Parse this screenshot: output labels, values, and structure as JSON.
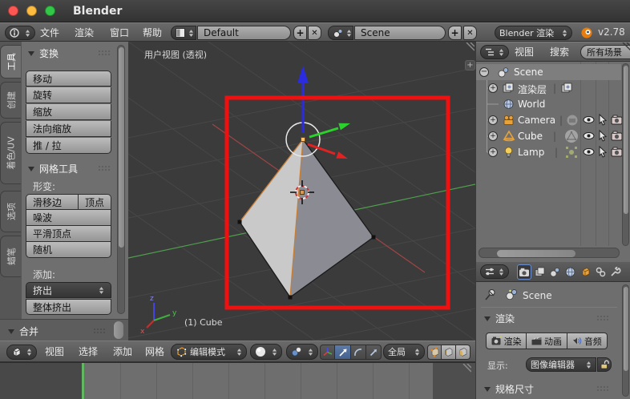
{
  "window": {
    "title": "Blender"
  },
  "topbar": {
    "menus": {
      "file": "文件",
      "render": "渲染",
      "window": "窗口",
      "help": "帮助"
    },
    "layout_name": "Default",
    "scene_name": "Scene",
    "engine": "Blender 渲染",
    "version": "v2.78",
    "add_btn": "+",
    "del_btn": "✕"
  },
  "toolshelf": {
    "tabs": {
      "tools": "工具",
      "create": "创建",
      "shading": "着色/UV",
      "options": "选项",
      "grease": "蜡笔"
    },
    "transform_title": "变换",
    "btn_translate": "移动",
    "btn_rotate": "旋转",
    "btn_scale": "缩放",
    "btn_shrink_fatten": "法向缩放",
    "btn_push_pull": "推 / 拉",
    "meshtools_title": "网格工具",
    "deform_label": "形变:",
    "btn_edge_slide": "滑移边",
    "btn_vertex": "顶点",
    "btn_noise": "噪波",
    "btn_smooth_vertex": "平滑顶点",
    "btn_randomize": "随机",
    "add_label": "添加:",
    "dd_extrude": "挤出",
    "btn_extrude_region": "整体挤出",
    "merge_title": "合并"
  },
  "viewport": {
    "view_label": "用户视图 (透视)",
    "object_label": "(1) Cube",
    "expand_btn": "+",
    "axis_x": "x",
    "axis_y": "y",
    "axis_z": "z"
  },
  "outliner": {
    "menus": {
      "view": "视图",
      "search": "搜索"
    },
    "display_mode": "所有场景",
    "separator": "|",
    "collapse": "−",
    "expand": "+",
    "rows": [
      {
        "name": "Scene"
      },
      {
        "name": "渲染层"
      },
      {
        "name": "World"
      },
      {
        "name": "Camera"
      },
      {
        "name": "Cube"
      },
      {
        "name": "Lamp"
      }
    ]
  },
  "properties": {
    "context": "Scene",
    "render_title": "渲染",
    "btn_render": "渲染",
    "btn_animation": "动画",
    "btn_audio": "音频",
    "display_label": "显示:",
    "display_value": "图像编辑器",
    "dimensions_title": "规格尺寸"
  },
  "view3d_header": {
    "menus": {
      "view": "视图",
      "select": "选择",
      "add": "添加",
      "mesh": "网格"
    },
    "mode": "编辑模式",
    "orientation": "全局"
  },
  "icons": {
    "traffic-close-icon": "red circle",
    "traffic-minimize-icon": "yellow circle",
    "traffic-zoom-icon": "green circle",
    "info-editor-icon": "circled i",
    "layout-icon": "split rectangle",
    "scene-icon": "two balls",
    "blender-logo-icon": "orange swirl",
    "outliner-editor-icon": "indented list",
    "world-icon": "globe",
    "renderlayer-icon": "stacked photos",
    "camera-object-icon": "orange camera",
    "cone-object-icon": "orange cone",
    "lamp-object-icon": "yellow bulb",
    "eye-icon": "visibility eye",
    "cursor-icon": "mouse pointer",
    "camera-restrict-icon": "small camera",
    "properties-editor-icon": "sliders",
    "tab-render-icon": "camera",
    "tab-renderlayers-icon": "photos",
    "tab-scene-icon": "balls",
    "tab-world-icon": "globe",
    "tab-object-icon": "orange cube",
    "tab-constraints-icon": "chain link",
    "tab-modifiers-icon": "wrench",
    "pin-icon": "push pin",
    "render-button-icon": "camera with star",
    "animation-button-icon": "clapperboard",
    "audio-button-icon": "speaker",
    "lock-icon": "open padlock",
    "view3d-editor-icon": "cube",
    "editmode-icon": "orange cube with vertices",
    "shading-sphere-icon": "white sphere",
    "pivot-icon": "two spheres",
    "manipulator-axes-icon": "rgb axes",
    "translate-icon": "arrow",
    "rotate-icon": "arc",
    "scale-icon": "diagonal arrow",
    "select-mode-cube-icon": "cube",
    "updown-arrows-icon": "double triangle",
    "grip-dots-icon": "drag dots",
    "resize-corner-icon": "diagonal lines"
  },
  "colors": {
    "annotation_red": "#f01010",
    "axis_x": "#e02222",
    "axis_y": "#2bd22b",
    "axis_z": "#2b2be0",
    "selected_orange": "#ffa133",
    "active_tab_blue": "#6a8fd0",
    "viewport_bg": "#3b3b3b",
    "header_gray": "#646464",
    "timeline_playhead_green": "#62b862"
  }
}
